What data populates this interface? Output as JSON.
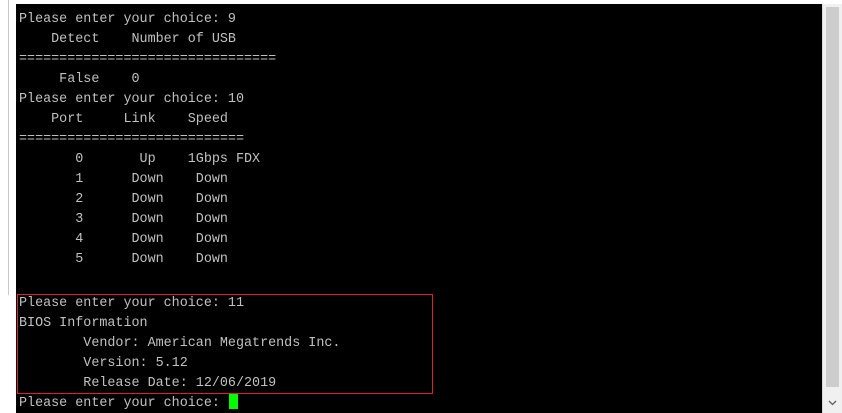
{
  "terminal": {
    "lines": [
      "Please enter your choice: 9",
      "    Detect    Number of USB",
      "================================",
      "     False    0",
      "Please enter your choice: 10",
      "    Port     Link    Speed",
      "============================",
      "       0       Up    1Gbps FDX",
      "       1      Down    Down",
      "       2      Down    Down",
      "       3      Down    Down",
      "       4      Down    Down",
      "       5      Down    Down",
      "",
      "Please enter your choice: 11",
      "BIOS Information",
      "        Vendor: American Megatrends Inc.",
      "        Version: 5.12",
      "        Release Date: 12/06/2019",
      "Please enter your choice: "
    ]
  },
  "colors": {
    "background": "#000000",
    "text": "#c0c0c0",
    "highlight_border": "#e0202a",
    "cursor": "#00ff00"
  },
  "scrollbar": {
    "down_arrow_icon": "chevron-down-icon"
  }
}
